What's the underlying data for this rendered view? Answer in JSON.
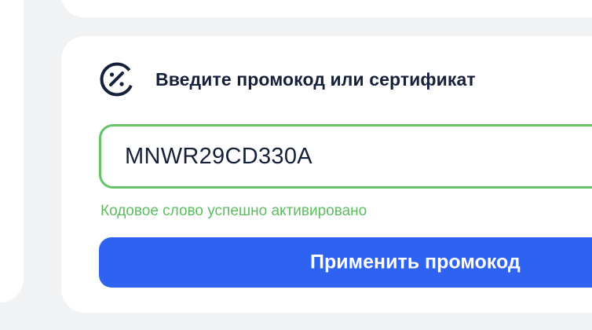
{
  "promo": {
    "icon": "discount-percent-icon",
    "title": "Введите промокод или сертификат",
    "code_value": "MNWR29CD330A",
    "status_text": "Кодовое слово успешно активировано",
    "apply_label": "Применить промокод"
  },
  "colors": {
    "background": "#f1f2f4",
    "card": "#ffffff",
    "title_text": "#15203a",
    "success_border": "#64c467",
    "success_text": "#5bbd5f",
    "primary_button": "#2e63f2"
  }
}
